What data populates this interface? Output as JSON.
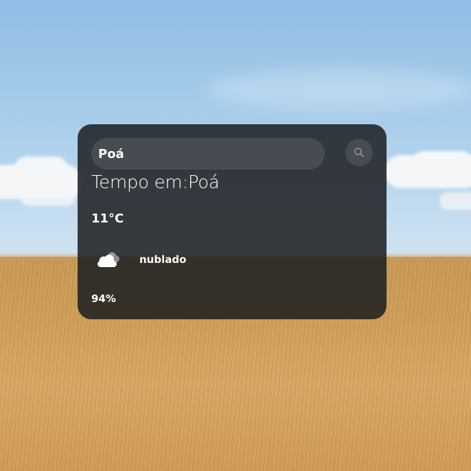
{
  "search": {
    "value": "Poá",
    "button_icon": "search-icon"
  },
  "weather": {
    "heading_prefix": "Tempo em:",
    "city": "Poá",
    "temperature": "11°C",
    "description": "nublado",
    "icon": "cloudy-icon",
    "humidity": "94%"
  },
  "colors": {
    "card_background": "#1c1e21",
    "text": "#ffffff",
    "sky": "#a7cdeb",
    "field": "#cf9f59"
  }
}
